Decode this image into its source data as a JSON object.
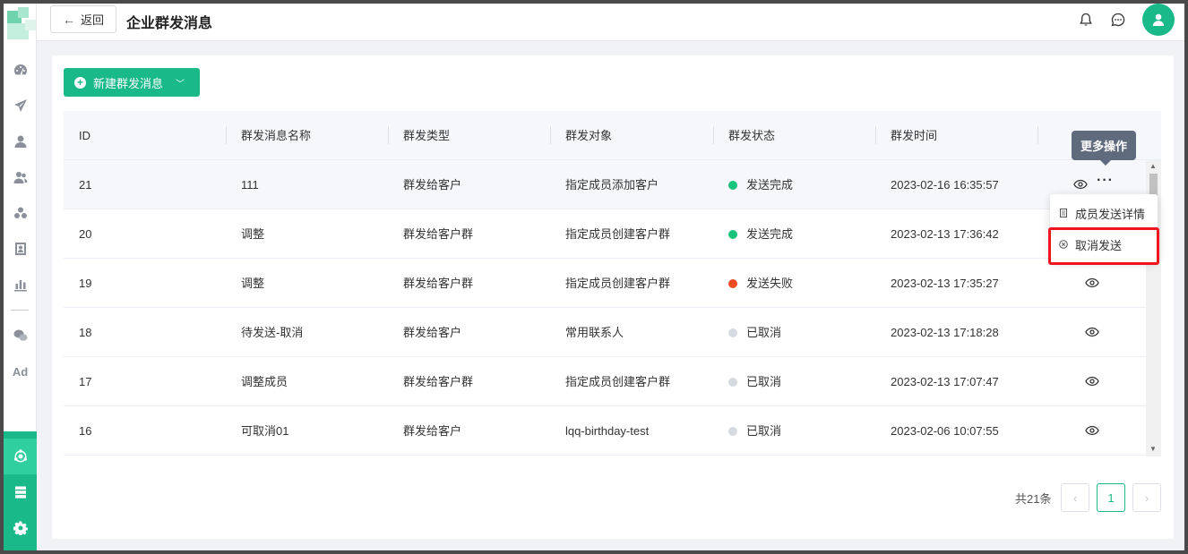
{
  "header": {
    "back_label": "返回",
    "title": "企业群发消息"
  },
  "toolbar": {
    "new_label": "新建群发消息"
  },
  "table": {
    "columns": [
      "ID",
      "群发消息名称",
      "群发类型",
      "群发对象",
      "群发状态",
      "群发时间"
    ],
    "rows": [
      {
        "id": "21",
        "name": "111",
        "type": "群发给客户",
        "target": "指定成员添加客户",
        "status": "发送完成",
        "status_color": "#19c37d",
        "time": "2023-02-16 16:35:57"
      },
      {
        "id": "20",
        "name": "调整",
        "type": "群发给客户群",
        "target": "指定成员创建客户群",
        "status": "发送完成",
        "status_color": "#19c37d",
        "time": "2023-02-13 17:36:42"
      },
      {
        "id": "19",
        "name": "调整",
        "type": "群发给客户群",
        "target": "指定成员创建客户群",
        "status": "发送失败",
        "status_color": "#f04d23",
        "time": "2023-02-13 17:35:27"
      },
      {
        "id": "18",
        "name": "待发送-取消",
        "type": "群发给客户",
        "target": "常用联系人",
        "status": "已取消",
        "status_color": "#d5dae0",
        "time": "2023-02-13 17:18:28"
      },
      {
        "id": "17",
        "name": "调整成员",
        "type": "群发给客户群",
        "target": "指定成员创建客户群",
        "status": "已取消",
        "status_color": "#d5dae0",
        "time": "2023-02-13 17:07:47"
      },
      {
        "id": "16",
        "name": "可取消01",
        "type": "群发给客户",
        "target": "lqq-birthday-test",
        "status": "已取消",
        "status_color": "#d5dae0",
        "time": "2023-02-06 10:07:55"
      }
    ]
  },
  "tooltip": {
    "label": "更多操作"
  },
  "dropdown": {
    "items": [
      "成员发送详情",
      "取消发送"
    ]
  },
  "pagination": {
    "total": "共21条",
    "current": "1"
  },
  "colors": {
    "accent": "#19b98a",
    "highlight": "#f0141e"
  }
}
